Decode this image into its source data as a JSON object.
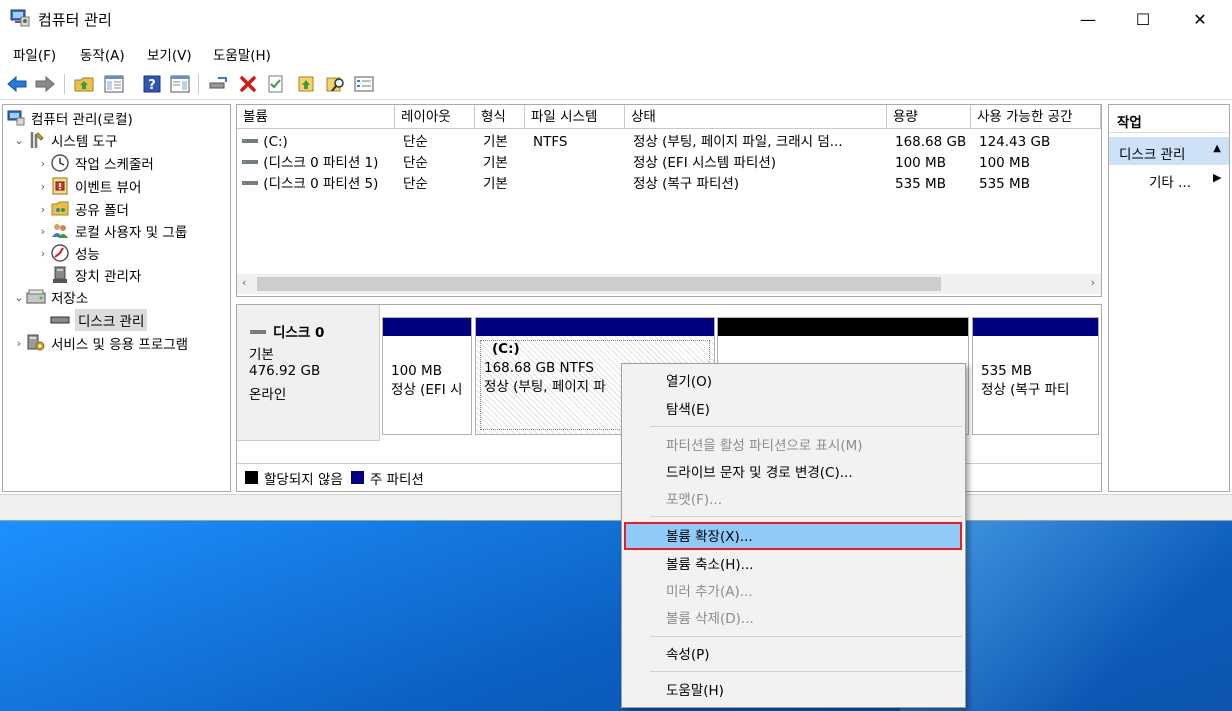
{
  "window": {
    "title": "컴퓨터 관리",
    "minimize": "—",
    "maximize": "☐",
    "close": "✕"
  },
  "menu": [
    "파일(F)",
    "동작(A)",
    "보기(V)",
    "도움말(H)"
  ],
  "tree": {
    "root": "컴퓨터 관리(로컬)",
    "system_tools": "시스템 도구",
    "task_scheduler": "작업 스케줄러",
    "event_viewer": "이벤트 뷰어",
    "shared_folders": "공유 폴더",
    "local_users": "로컬 사용자 및 그룹",
    "performance": "성능",
    "device_manager": "장치 관리자",
    "storage": "저장소",
    "disk_management": "디스크 관리",
    "services": "서비스 및 응용 프로그램"
  },
  "volume_table": {
    "columns": [
      "볼륨",
      "레이아웃",
      "형식",
      "파일 시스템",
      "상태",
      "용량",
      "사용 가능한 공간"
    ],
    "rows": [
      [
        "(C:)",
        "단순",
        "기본",
        "NTFS",
        "정상 (부팅, 페이지 파일, 크래시 덤...",
        "168.68 GB",
        "124.43 GB"
      ],
      [
        "(디스크 0 파티션 1)",
        "단순",
        "기본",
        "",
        "정상 (EFI 시스템 파티션)",
        "100 MB",
        "100 MB"
      ],
      [
        "(디스크 0 파티션 5)",
        "단순",
        "기본",
        "",
        "정상 (복구 파티션)",
        "535 MB",
        "535 MB"
      ]
    ]
  },
  "disk": {
    "name": "디스크 0",
    "type": "기본",
    "size": "476.92 GB",
    "status": "온라인",
    "partitions": {
      "efi": {
        "size": "100 MB",
        "status": "정상 (EFI 시"
      },
      "c": {
        "label": "(C:)",
        "size": "168.68 GB NTFS",
        "status": "정상 (부팅, 페이지 파"
      },
      "recovery": {
        "size": "535 MB",
        "status": "정상 (복구 파티"
      }
    }
  },
  "legend": {
    "unallocated": "할당되지 않음",
    "primary": "주 파티션"
  },
  "actions": {
    "title": "작업",
    "section": "디스크 관리",
    "more": "기타 ..."
  },
  "context_menu": {
    "open": "열기(O)",
    "explore": "탐색(E)",
    "mark_active": "파티션을 활성 파티션으로 표시(M)",
    "change_letter": "드라이브 문자 및 경로 변경(C)...",
    "format": "포맷(F)...",
    "extend": "볼륨 확장(X)...",
    "shrink": "볼륨 축소(H)...",
    "add_mirror": "미러 추가(A)...",
    "delete": "볼륨 삭제(D)...",
    "properties": "속성(P)",
    "help": "도움말(H)"
  },
  "colors": {
    "primary_partition": "#000080",
    "unallocated": "#000000",
    "highlight": "#91c9f7",
    "highlight_border": "#e0202a"
  }
}
